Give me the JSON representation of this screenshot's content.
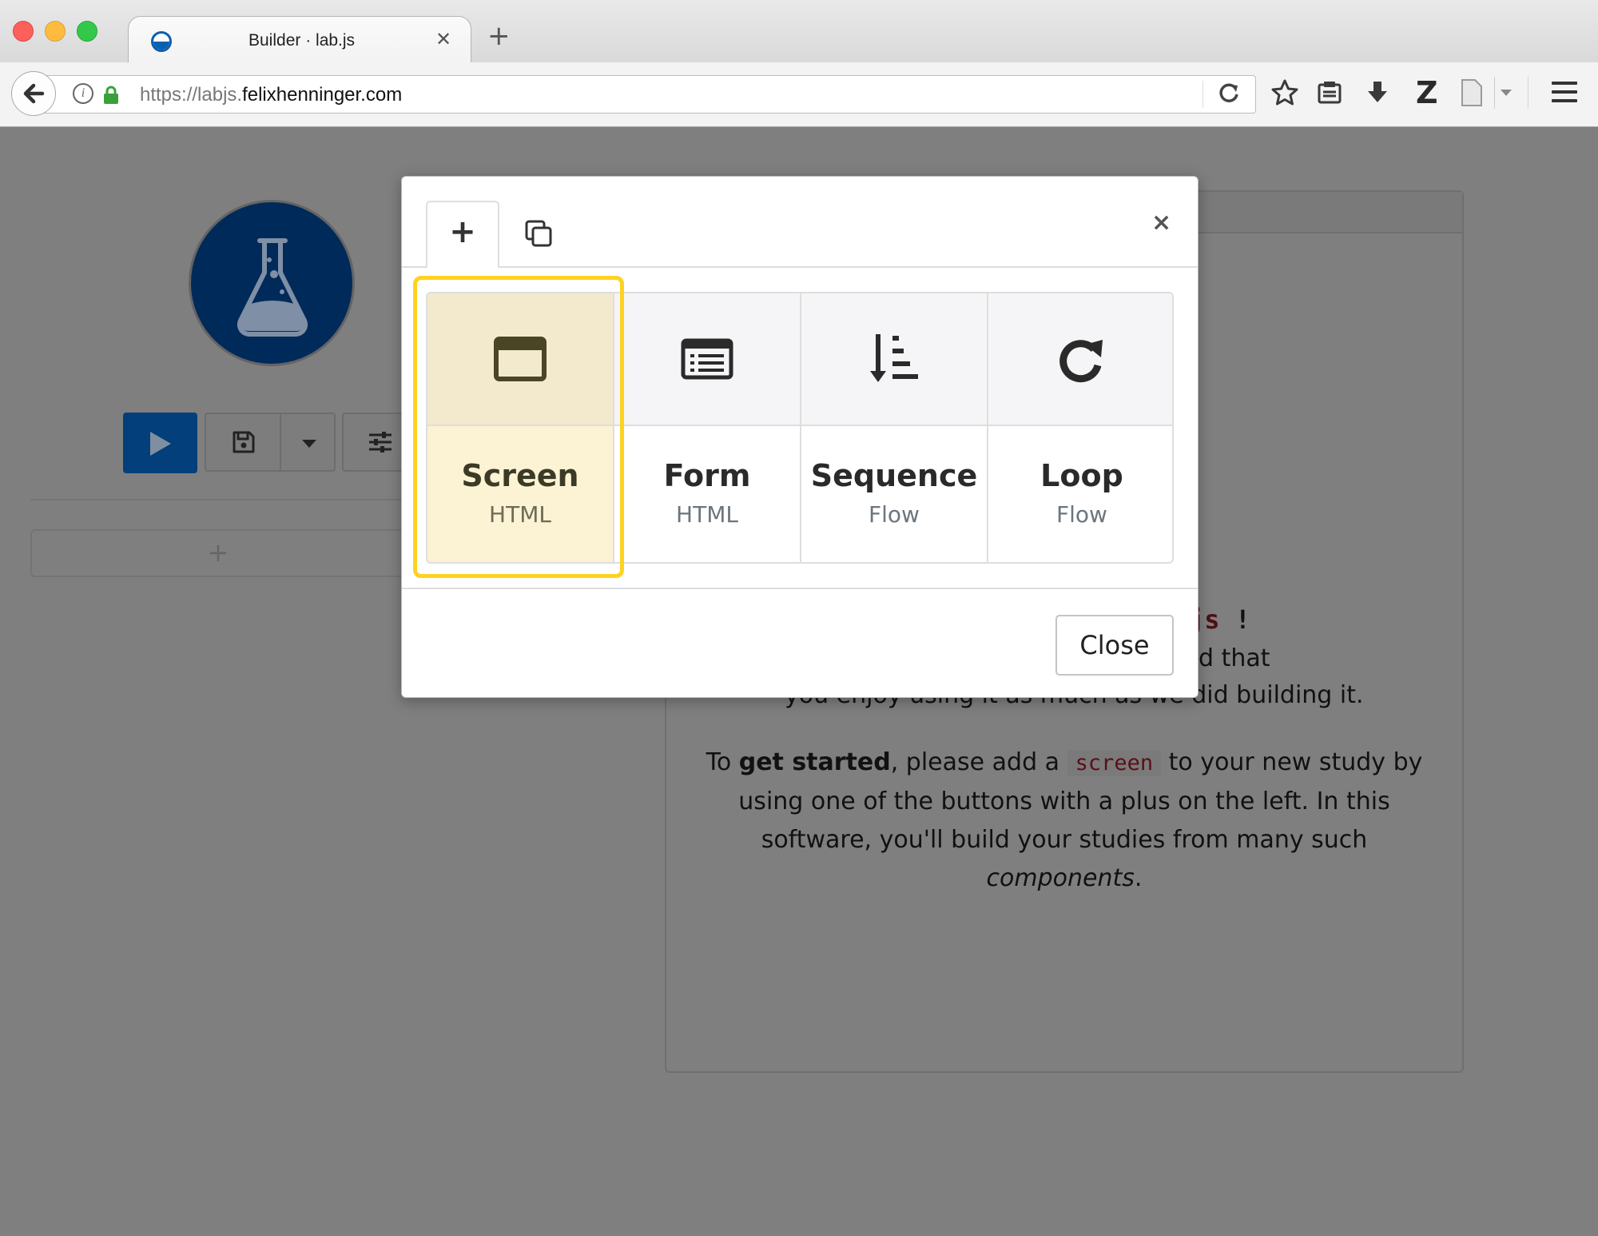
{
  "browser": {
    "tab_title": "Builder · lab.js",
    "url_prefix": "https://labjs.",
    "url_domain": "felixhenninger.com",
    "icons": [
      "back-arrow-icon",
      "info-icon",
      "lock-icon",
      "reload-icon",
      "bookmark-star-icon",
      "reading-list-icon",
      "download-icon",
      "zotero-icon",
      "page-icon",
      "hamburger-menu-icon"
    ]
  },
  "sidebar": {
    "icons": [
      "flask-logo-icon",
      "play-icon",
      "save-icon",
      "caret-down-icon",
      "sliders-icon",
      "plus-icon"
    ],
    "add_label": "+"
  },
  "welcome": {
    "heading_code": "js",
    "heading_punct": " !",
    "line1_tail": "d that",
    "line2": "you enjoy using it as much as we did building it.",
    "para2_prefix": "To ",
    "para2_bold": "get started",
    "para2_mid": ", please add a ",
    "para2_code": "screen",
    "para2_rest": " to your new study by using one of the buttons with a plus on the left. In this software, you'll build your studies from many such ",
    "para2_em": "components",
    "para2_end": "."
  },
  "modal": {
    "close_x": "×",
    "close_button": "Close",
    "types": [
      {
        "title": "Screen",
        "subtitle": "HTML",
        "icon": "window-icon"
      },
      {
        "title": "Form",
        "subtitle": "HTML",
        "icon": "form-list-icon"
      },
      {
        "title": "Sequence",
        "subtitle": "Flow",
        "icon": "sort-amount-icon"
      },
      {
        "title": "Loop",
        "subtitle": "Flow",
        "icon": "redo-icon"
      }
    ],
    "highlight_color": "#ffd21f"
  },
  "colors": {
    "backdrop": "#7f7f7f",
    "brand_blue": "#003366",
    "highlight": "#ffd21f",
    "code_red": "#c7254e"
  }
}
